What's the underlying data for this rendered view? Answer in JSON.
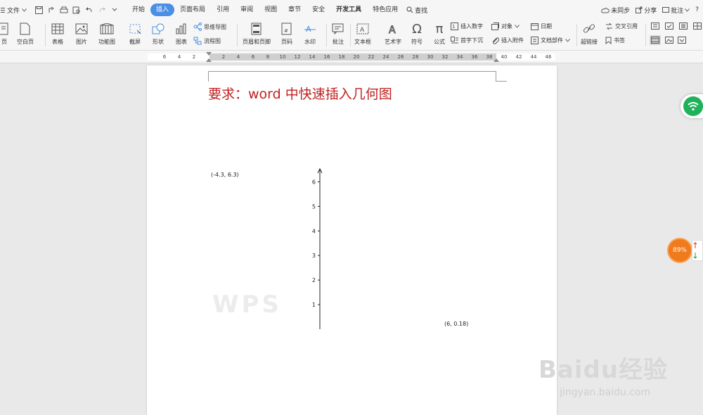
{
  "menubar": {
    "file_label": "文件",
    "tabs": [
      {
        "label": "开始"
      },
      {
        "label": "插入"
      },
      {
        "label": "页面布局"
      },
      {
        "label": "引用"
      },
      {
        "label": "审阅"
      },
      {
        "label": "视图"
      },
      {
        "label": "章节"
      },
      {
        "label": "安全"
      },
      {
        "label": "开发工具"
      },
      {
        "label": "特色应用"
      }
    ],
    "search_label": "查找",
    "right": {
      "sync": "未同步",
      "share": "分享",
      "comment": "批注",
      "help": "?"
    }
  },
  "ribbon": {
    "page_cut": "页",
    "blank_page": "空白页",
    "table": "表格",
    "picture": "图片",
    "function_chart": "功能图",
    "screenshot": "截屏",
    "shape": "形状",
    "chart": "图表",
    "mindmap": "思维导图",
    "flowchart": "流程图",
    "header_footer": "页眉和页脚",
    "page_number": "页码",
    "watermark": "水印",
    "annotation": "批注",
    "textbox": "文本框",
    "wordart": "艺术字",
    "symbol": "符号",
    "formula": "公式",
    "insert_number": "插入数字",
    "object": "对象",
    "date": "日期",
    "drop_cap": "首字下沉",
    "attachment": "插入附件",
    "doc_parts": "文档部件",
    "hyperlink": "超链接",
    "cross_ref": "交叉引用",
    "bookmark": "书签"
  },
  "ruler": {
    "numbers": [
      "6",
      "4",
      "2",
      "",
      "2",
      "4",
      "6",
      "8",
      "10",
      "12",
      "14",
      "16",
      "18",
      "20",
      "22",
      "24",
      "26",
      "28",
      "30",
      "32",
      "34",
      "36",
      "38",
      "40",
      "42",
      "44",
      "46"
    ]
  },
  "document": {
    "title": "要求：word 中快速插入几何图",
    "point_a_label": "(-4.3, 6.3)",
    "point_b_label": "(6, 0.18)",
    "watermark_text": "WPS"
  },
  "widgets": {
    "zoom": "89%",
    "baidu_logo": "Baidu经验",
    "baidu_url": "jingyan.baidu.com"
  },
  "chart_data": {
    "type": "line",
    "x": [],
    "y_ticks": [
      1,
      2,
      3,
      4,
      5,
      6
    ],
    "ylim": [
      0,
      6.3
    ],
    "grid": false,
    "title": "",
    "xlabel": "",
    "ylabel": ""
  }
}
